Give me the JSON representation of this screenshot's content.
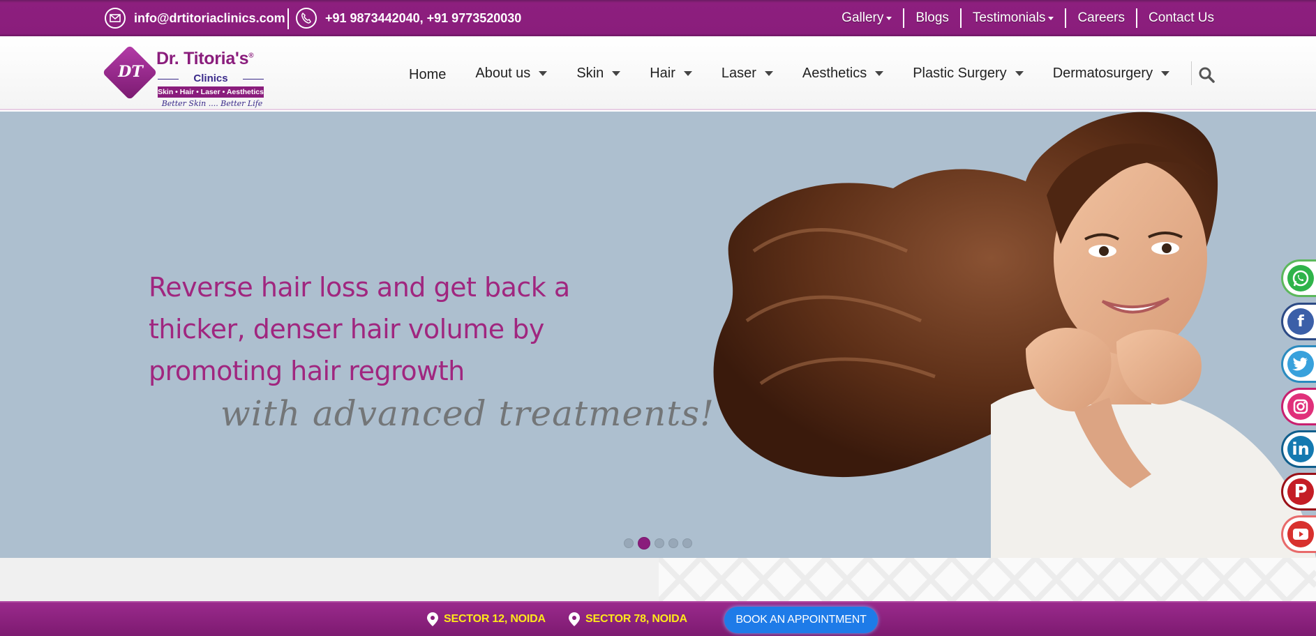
{
  "topbar": {
    "email": "info@drtitoriaclinics.com",
    "phone": "+91 9873442040, +91 9773520030",
    "links": [
      "Gallery",
      "Blogs",
      "Testimonials",
      "Careers",
      "Contact Us"
    ]
  },
  "logo": {
    "initials": "DT",
    "name": "Dr. Titoria's",
    "registered": "®",
    "sub": "Clinics",
    "services": "Skin • Hair • Laser • Aesthetics",
    "motto": "Better Skin .... Better Life"
  },
  "nav": {
    "items": [
      "Home",
      "About us",
      "Skin",
      "Hair",
      "Laser",
      "Aesthetics",
      "Plastic Surgery",
      "Dermatosurgery"
    ]
  },
  "hero": {
    "headline": "Reverse hair loss and get back a thicker, denser hair volume by promoting hair regrowth",
    "script": "with advanced treatments!",
    "slide_count": 5,
    "active_slide": 2
  },
  "bottombar": {
    "location_1": "SECTOR 12, NOIDA",
    "location_2": "SECTOR 78, NOIDA",
    "book_label": "BOOK AN APPOINTMENT"
  },
  "social": [
    {
      "name": "whatsapp-icon",
      "border": "#5cb85c",
      "bg": "#2fb34a"
    },
    {
      "name": "facebook-icon",
      "border": "#2c4a85",
      "bg": "#3b5fa8"
    },
    {
      "name": "twitter-icon",
      "border": "#2a8bbf",
      "bg": "#38a1dc"
    },
    {
      "name": "instagram-icon",
      "border": "#c8206f",
      "bg": "#e0307a"
    },
    {
      "name": "linkedin-icon",
      "border": "#0f5e8c",
      "bg": "#1479b0"
    },
    {
      "name": "pinterest-icon",
      "border": "#9a1018",
      "bg": "#c41d25"
    },
    {
      "name": "youtube-icon",
      "border": "#e86a6a",
      "bg": "#d8312e"
    }
  ],
  "colors": {
    "brand_purple": "#8a1d7c",
    "headline_pink": "#a0267f",
    "hero_bg": "#adbfcf",
    "location_yellow": "#ffe81a",
    "button_blue": "#1e7be8"
  }
}
